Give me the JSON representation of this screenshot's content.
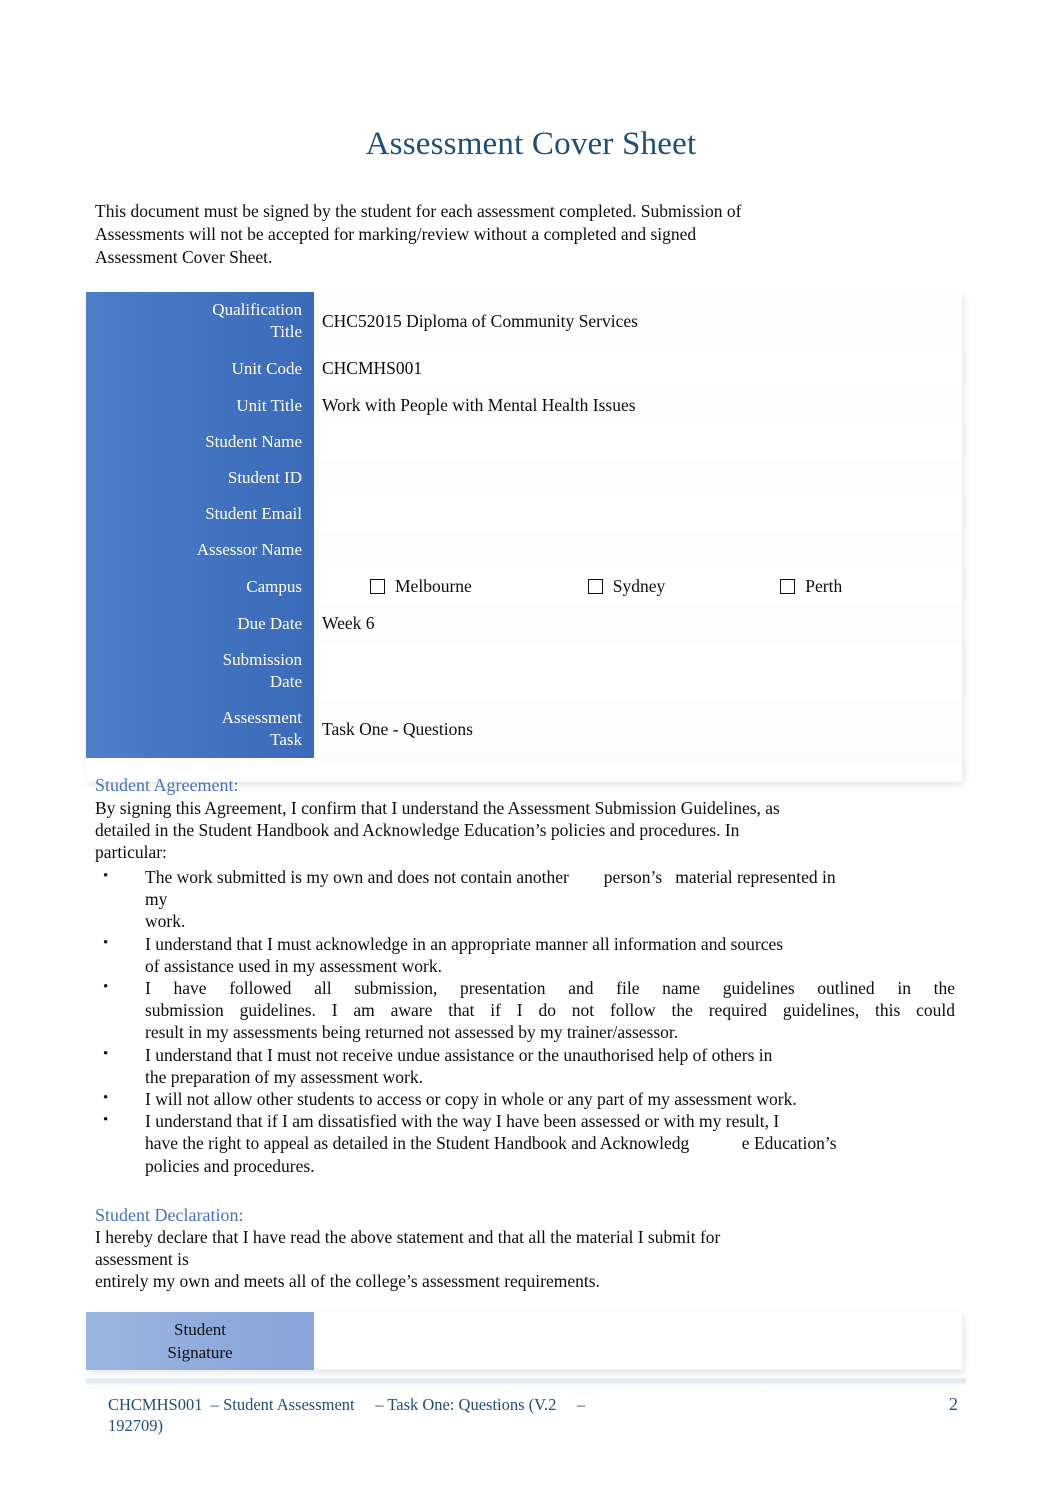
{
  "document": {
    "title": "Assessment Cover Sheet",
    "intro": "This document must be signed by the student for each assessment completed. Submission of Assessments will not be accepted for marking/review without a completed and signed Assessment Cover Sheet.",
    "intro_lines": [
      "This document must be signed by the student for each assessment completed. Submission of",
      "Assessments will not be accepted for marking/review without a completed and signed",
      "Assessment Cover Sheet."
    ]
  },
  "cover_table": {
    "rows": [
      {
        "label": "Qualification Title",
        "label_lines": [
          "Qualification",
          "Title"
        ],
        "value": "CHC52015 Diploma of Community Services",
        "tall": true
      },
      {
        "label": "Unit Code",
        "label_lines": [
          "Unit Code"
        ],
        "value": "CHCMHS001",
        "tall": false
      },
      {
        "label": "Unit Title",
        "label_lines": [
          "Unit Title"
        ],
        "value": "Work with People with Mental Health Issues",
        "tall": false
      },
      {
        "label": "Student Name",
        "label_lines": [
          "Student Name"
        ],
        "value": "",
        "tall": false
      },
      {
        "label": "Student ID",
        "label_lines": [
          "Student ID"
        ],
        "value": "",
        "tall": false
      },
      {
        "label": "Student Email",
        "label_lines": [
          "Student Email"
        ],
        "value": "",
        "tall": false
      },
      {
        "label": "Assessor Name",
        "label_lines": [
          "Assessor Name"
        ],
        "value": "",
        "tall": false
      },
      {
        "label": "Campus",
        "label_lines": [
          "Campus"
        ],
        "value": "",
        "tall": false,
        "type": "campus"
      },
      {
        "label": "Due Date",
        "label_lines": [
          "Due Date"
        ],
        "value": "Week 6",
        "tall": false
      },
      {
        "label": "Submission Date",
        "label_lines": [
          "Submission",
          "Date"
        ],
        "value": "",
        "tall": true
      },
      {
        "label": "Assessment Task",
        "label_lines": [
          "Assessment",
          "Task"
        ],
        "value": "Task One - Questions",
        "tall": true
      }
    ],
    "campus_options": [
      {
        "label": "Melbourne",
        "checked": false
      },
      {
        "label": "Sydney",
        "checked": false
      },
      {
        "label": "Perth",
        "checked": false
      }
    ]
  },
  "student_agreement": {
    "heading": "Student Agreement:",
    "lead_lines": [
      "By signing this Agreement, I confirm that I understand the Assessment Submission Guidelines, as",
      "detailed in the Student Handbook and Acknowledge Education’s policies and procedures. In",
      "particular:"
    ],
    "bullets": [
      {
        "lines": [
          "The work submitted is my own and does not contain another        person’s   material represented in",
          "my",
          "work."
        ]
      },
      {
        "lines": [
          "I understand that I must acknowledge in an appropriate manner all information and sources",
          "of assistance used in my assessment work."
        ]
      },
      {
        "justified": [
          true,
          true,
          false
        ],
        "lines": [
          "I have followed all submission, presentation and file name guidelines outlined in the",
          "submission guidelines. I am aware that if I do not follow the required guidelines, this could",
          "result in my assessments being returned not assessed by my trainer/assessor."
        ]
      },
      {
        "lines": [
          "I understand that I must not receive undue assistance or the unauthorised help of others in",
          "the preparation of my assessment work."
        ]
      },
      {
        "lines": [
          "I will not allow other students to access or copy in whole or any part of my assessment work."
        ]
      },
      {
        "lines": [
          "I understand that if I am dissatisfied with the way I have been assessed or with my result, I",
          "have the right to appeal as detailed in the Student Handbook and Acknowledg            e Education’s",
          "policies and procedures."
        ]
      }
    ]
  },
  "student_declaration": {
    "heading": "Student Declaration:",
    "lines": [
      "I hereby declare that I have read the above statement and that all the material I submit for",
      "assessment is",
      "entirely my own and meets all of the college’s assessment requirements."
    ]
  },
  "signature_table": {
    "label_lines": [
      "Student",
      "Signature"
    ],
    "label": "Student Signature",
    "value": ""
  },
  "footer": {
    "text_line_1": "CHCMHS001  – Student Assessment     – Task One: Questions (V.2     –",
    "text_line_2": "192709)",
    "page_number": "2"
  },
  "colors": {
    "title_blue": "#1F4E79",
    "heading_blue": "#4472C4",
    "table_header_blue": "#4472C4",
    "signature_header_blue": "#9DB5E0",
    "footer_blue": "#1F4E79",
    "body_black": "#0d0d0d"
  }
}
